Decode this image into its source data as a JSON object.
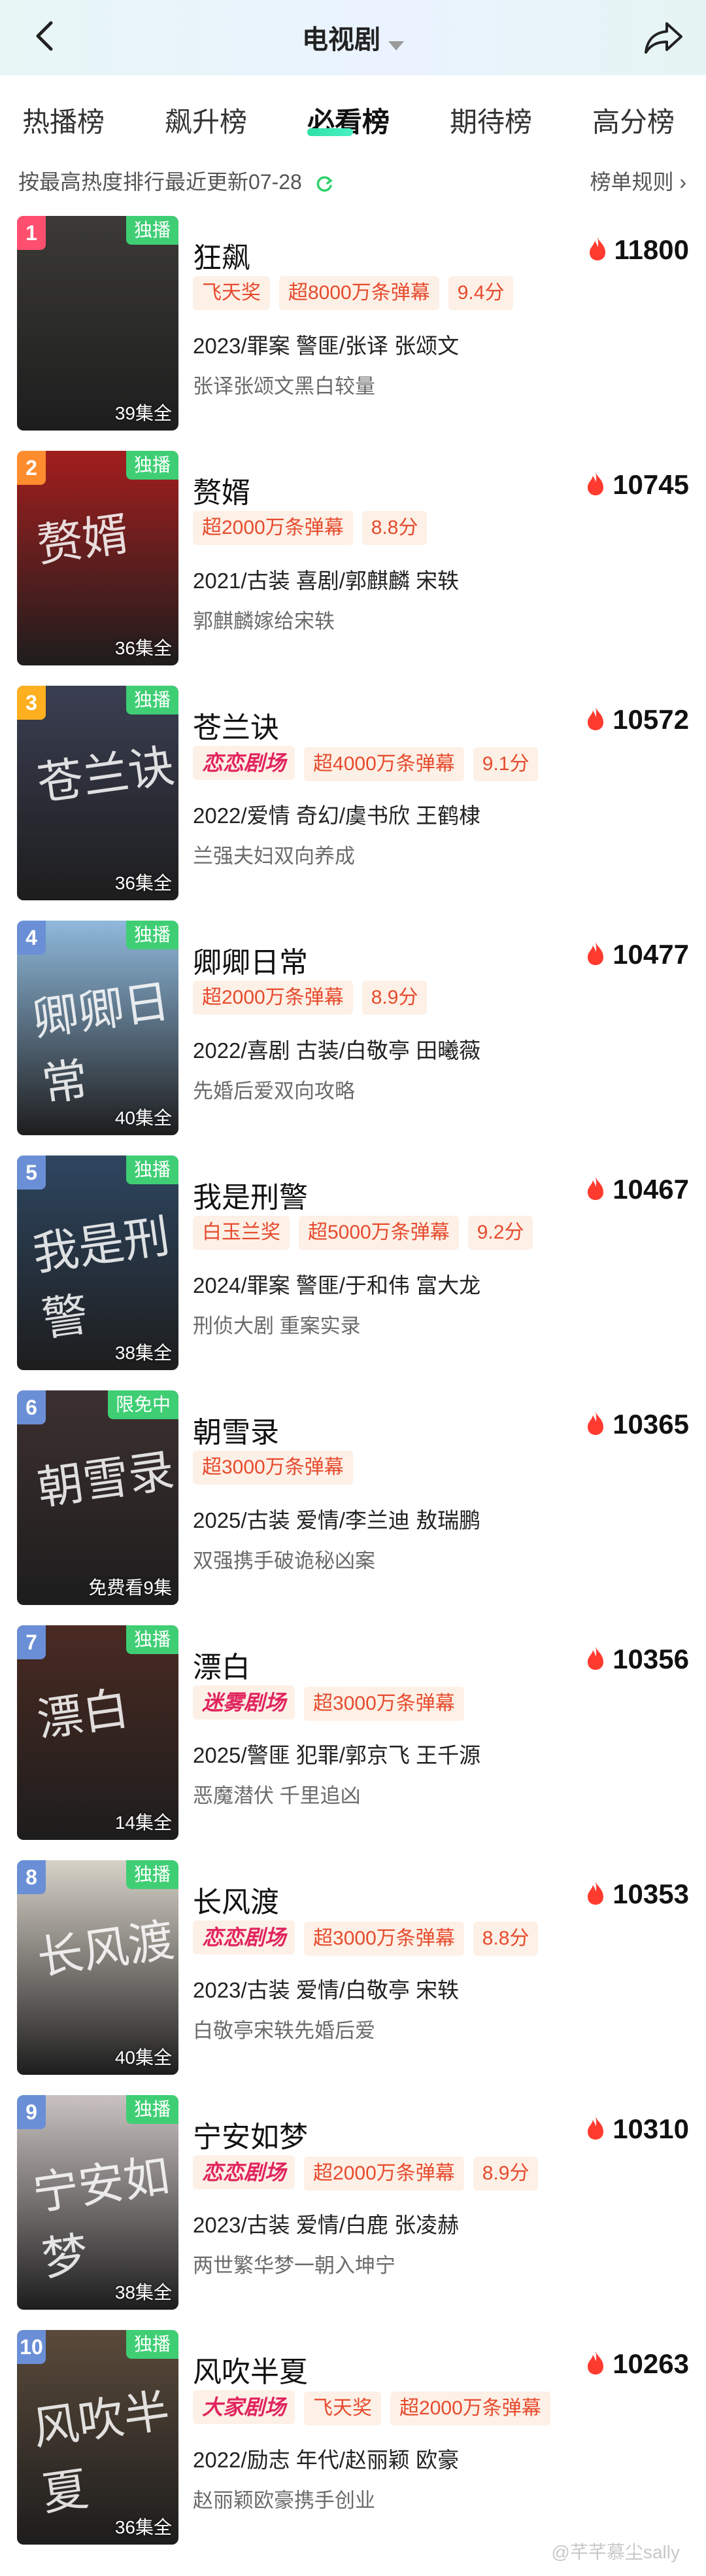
{
  "header": {
    "title": "电视剧"
  },
  "tabs": [
    {
      "label": "热播榜"
    },
    {
      "label": "飙升榜"
    },
    {
      "label": "必看榜",
      "active": true
    },
    {
      "label": "期待榜"
    },
    {
      "label": "高分榜"
    }
  ],
  "subbar": {
    "left": "按最高热度排行最近更新07-28",
    "right": "榜单规则 ›"
  },
  "colors": {
    "accent": "#2fe0a5",
    "flame": "#ff3b30",
    "badge_text": "#e64b2e",
    "tag_green": "#3fce74"
  },
  "items": [
    {
      "rank": "1",
      "tag": "独播",
      "episodes": "39集全",
      "title": "狂飙",
      "heat": "11800",
      "badges": [
        "飞天奖",
        "超8000万条弹幕",
        "9.4分"
      ],
      "meta": "2023/罪案 警匪/张译 张颂文",
      "desc": "张译张颂文黑白较量",
      "rank_color": "#ff4f6e"
    },
    {
      "rank": "2",
      "tag": "独播",
      "episodes": "36集全",
      "title": "赘婿",
      "heat": "10745",
      "badges": [
        "超2000万条弹幕",
        "8.8分"
      ],
      "meta": "2021/古装 喜剧/郭麒麟 宋轶",
      "desc": "郭麒麟嫁给宋轶",
      "rank_color": "#ff8c2e"
    },
    {
      "rank": "3",
      "tag": "独播",
      "episodes": "36集全",
      "title": "苍兰诀",
      "heat": "10572",
      "brand": "恋恋剧场",
      "badges": [
        "超4000万条弹幕",
        "9.1分"
      ],
      "meta": "2022/爱情 奇幻/虞书欣 王鹤棣",
      "desc": "兰强夫妇双向养成",
      "rank_color": "#ffb020"
    },
    {
      "rank": "4",
      "tag": "独播",
      "episodes": "40集全",
      "title": "卿卿日常",
      "heat": "10477",
      "badges": [
        "超2000万条弹幕",
        "8.9分"
      ],
      "meta": "2022/喜剧 古装/白敬亭 田曦薇",
      "desc": "先婚后爱双向攻略",
      "rank_color": "#6a8fd6"
    },
    {
      "rank": "5",
      "tag": "独播",
      "episodes": "38集全",
      "title": "我是刑警",
      "heat": "10467",
      "badges": [
        "白玉兰奖",
        "超5000万条弹幕",
        "9.2分"
      ],
      "meta": "2024/罪案 警匪/于和伟 富大龙",
      "desc": "刑侦大剧 重案实录",
      "rank_color": "#6a8fd6"
    },
    {
      "rank": "6",
      "tag": "限免中",
      "episodes": "免费看9集",
      "title": "朝雪录",
      "heat": "10365",
      "badges": [
        "超3000万条弹幕"
      ],
      "meta": "2025/古装 爱情/李兰迪 敖瑞鹏",
      "desc": "双强携手破诡秘凶案",
      "rank_color": "#6a8fd6"
    },
    {
      "rank": "7",
      "tag": "独播",
      "episodes": "14集全",
      "title": "漂白",
      "heat": "10356",
      "brand": "迷雾剧场",
      "badges": [
        "超3000万条弹幕"
      ],
      "meta": "2025/警匪 犯罪/郭京飞 王千源",
      "desc": "恶魔潜伏 千里追凶",
      "rank_color": "#6a8fd6"
    },
    {
      "rank": "8",
      "tag": "独播",
      "episodes": "40集全",
      "title": "长风渡",
      "heat": "10353",
      "brand": "恋恋剧场",
      "badges": [
        "超3000万条弹幕",
        "8.8分"
      ],
      "meta": "2023/古装 爱情/白敬亭 宋轶",
      "desc": "白敬亭宋轶先婚后爱",
      "rank_color": "#6a8fd6"
    },
    {
      "rank": "9",
      "tag": "独播",
      "episodes": "38集全",
      "title": "宁安如梦",
      "heat": "10310",
      "brand": "恋恋剧场",
      "badges": [
        "超2000万条弹幕",
        "8.9分"
      ],
      "meta": "2023/古装 爱情/白鹿 张凌赫",
      "desc": "两世繁华梦一朝入坤宁",
      "rank_color": "#6a8fd6"
    },
    {
      "rank": "10",
      "tag": "独播",
      "episodes": "36集全",
      "title": "风吹半夏",
      "heat": "10263",
      "brand": "大家剧场",
      "badges": [
        "飞天奖",
        "超2000万条弹幕"
      ],
      "meta": "2022/励志 年代/赵丽颖 欧豪",
      "desc": "赵丽颖欧豪携手创业",
      "rank_color": "#6a8fd6"
    }
  ],
  "posters": [
    {
      "bg": "#3b3a36",
      "mark": ""
    },
    {
      "bg": "#a31e1e",
      "mark": "赘婿"
    },
    {
      "bg": "#3a3f52",
      "mark": "苍兰诀"
    },
    {
      "bg": "#8fb9dc",
      "mark": "卿卿日常"
    },
    {
      "bg": "#2e4660",
      "mark": "我是刑警"
    },
    {
      "bg": "#3d3030",
      "mark": "朝雪录"
    },
    {
      "bg": "#4a2a22",
      "mark": "漂白"
    },
    {
      "bg": "#d7d2c8",
      "mark": "长风渡"
    },
    {
      "bg": "#c9c2c0",
      "mark": "宁安如梦"
    },
    {
      "bg": "#5a4a3a",
      "mark": "风吹半夏"
    }
  ],
  "watermark": "@芊芊慕尘sally"
}
